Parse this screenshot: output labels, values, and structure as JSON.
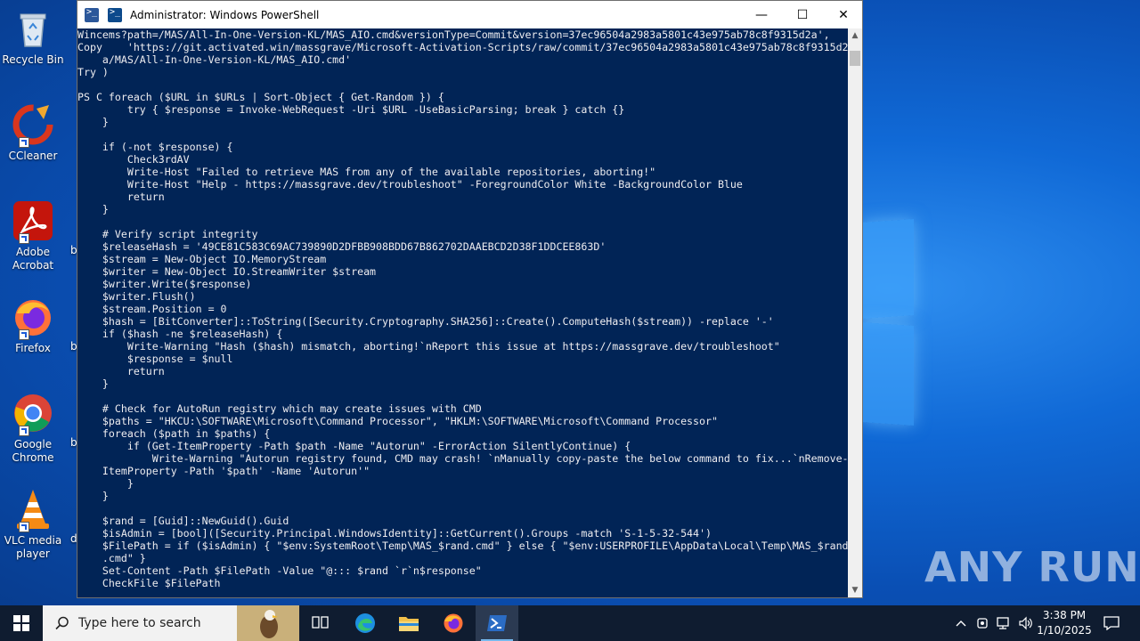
{
  "desktop": {
    "icons": [
      {
        "label": "Recycle Bin",
        "icon": "recycle-bin-icon"
      },
      {
        "label": "CCleaner",
        "icon": "ccleaner-icon"
      },
      {
        "label": "Adobe Acrobat",
        "icon": "adobe-acrobat-icon"
      },
      {
        "label": "Firefox",
        "icon": "firefox-icon"
      },
      {
        "label": "Google Chrome",
        "icon": "chrome-icon"
      },
      {
        "label": "VLC media player",
        "icon": "vlc-icon"
      }
    ],
    "peek_letters": [
      "b",
      "b",
      "b",
      "b",
      "d"
    ],
    "watermark": "ANY RUN"
  },
  "window": {
    "title": "Administrator: Windows PowerShell",
    "controls": {
      "minimize": "—",
      "maximize": "☐",
      "close": "✕"
    }
  },
  "console": {
    "lines": [
      "Wincems?path=/MAS/All-In-One-Version-KL/MAS_AIO.cmd&versionType=Commit&version=37ec96504a2983a5801c43e975ab78c8f9315d2a',",
      "Copy    'https://git.activated.win/massgrave/Microsoft-Activation-Scripts/raw/commit/37ec96504a2983a5801c43e975ab78c8f9315d2",
      "    a/MAS/All-In-One-Version-KL/MAS_AIO.cmd'",
      "Try )",
      "",
      "PS C foreach ($URL in $URLs | Sort-Object { Get-Random }) {",
      "        try { $response = Invoke-WebRequest -Uri $URL -UseBasicParsing; break } catch {}",
      "    }",
      "",
      "    if (-not $response) {",
      "        Check3rdAV",
      "        Write-Host \"Failed to retrieve MAS from any of the available repositories, aborting!\"",
      "        Write-Host \"Help - https://massgrave.dev/troubleshoot\" -ForegroundColor White -BackgroundColor Blue",
      "        return",
      "    }",
      "",
      "    # Verify script integrity",
      "    $releaseHash = '49CE81C583C69AC739890D2DFBB908BDD67B862702DAAEBCD2D38F1DDCEE863D'",
      "    $stream = New-Object IO.MemoryStream",
      "    $writer = New-Object IO.StreamWriter $stream",
      "    $writer.Write($response)",
      "    $writer.Flush()",
      "    $stream.Position = 0",
      "    $hash = [BitConverter]::ToString([Security.Cryptography.SHA256]::Create().ComputeHash($stream)) -replace '-'",
      "    if ($hash -ne $releaseHash) {",
      "        Write-Warning \"Hash ($hash) mismatch, aborting!`nReport this issue at https://massgrave.dev/troubleshoot\"",
      "        $response = $null",
      "        return",
      "    }",
      "",
      "    # Check for AutoRun registry which may create issues with CMD",
      "    $paths = \"HKCU:\\SOFTWARE\\Microsoft\\Command Processor\", \"HKLM:\\SOFTWARE\\Microsoft\\Command Processor\"",
      "    foreach ($path in $paths) {",
      "        if (Get-ItemProperty -Path $path -Name \"Autorun\" -ErrorAction SilentlyContinue) {",
      "            Write-Warning \"Autorun registry found, CMD may crash! `nManually copy-paste the below command to fix...`nRemove-",
      "    ItemProperty -Path '$path' -Name 'Autorun'\"",
      "        }",
      "    }",
      "",
      "    $rand = [Guid]::NewGuid().Guid",
      "    $isAdmin = [bool]([Security.Principal.WindowsIdentity]::GetCurrent().Groups -match 'S-1-5-32-544')",
      "    $FilePath = if ($isAdmin) { \"$env:SystemRoot\\Temp\\MAS_$rand.cmd\" } else { \"$env:USERPROFILE\\AppData\\Local\\Temp\\MAS_$rand",
      "    .cmd\" }",
      "    Set-Content -Path $FilePath -Value \"@::: $rand `r`n$response\"",
      "    CheckFile $FilePath"
    ]
  },
  "taskbar": {
    "search_placeholder": "Type here to search",
    "apps": [
      "task-view-icon",
      "edge-icon",
      "file-explorer-icon",
      "firefox-icon",
      "powershell-icon"
    ],
    "active_app": "powershell-icon",
    "clock": {
      "time": "3:38 PM",
      "date": "1/10/2025"
    },
    "tray_icons": [
      "chevron-up-icon",
      "cloud-icon",
      "network-icon",
      "volume-icon",
      "notification-icon"
    ]
  },
  "colors": {
    "console_bg": "#012456",
    "console_fg": "#eeedf0",
    "taskbar_bg": "#0f1c30"
  }
}
